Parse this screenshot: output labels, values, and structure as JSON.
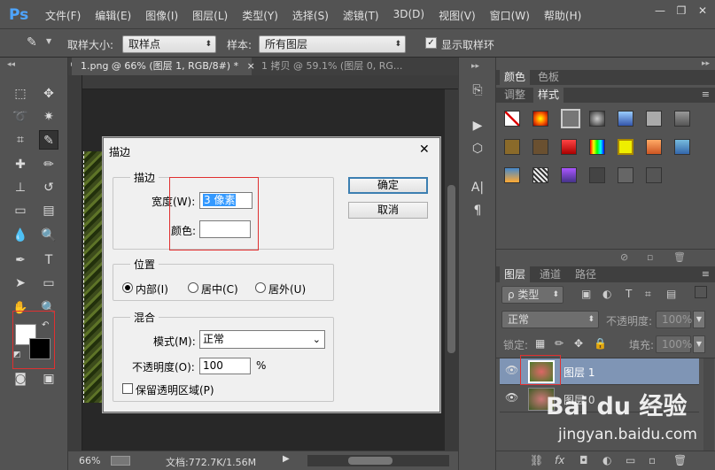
{
  "app": {
    "logo": "Ps"
  },
  "menu": [
    "文件(F)",
    "编辑(E)",
    "图像(I)",
    "图层(L)",
    "类型(Y)",
    "选择(S)",
    "滤镜(T)",
    "3D(D)",
    "视图(V)",
    "窗口(W)",
    "帮助(H)"
  ],
  "window_controls": {
    "minimize": "—",
    "restore": "❐",
    "close": "✕"
  },
  "options": {
    "sample_size_label": "取样大小:",
    "sample_size_value": "取样点",
    "sample_label": "样本:",
    "sample_value": "所有图层",
    "show_ring_label": "显示取样环",
    "show_ring_checked": true
  },
  "tabs": [
    {
      "label": "1.png @ 66% (图层 1, RGB/8#) *",
      "close": "×",
      "active": true
    },
    {
      "label": "1 拷贝 @ 59.1% (图层 0, RG...",
      "active": false
    }
  ],
  "status": {
    "zoom": "66%",
    "doc": "文档:772.7K/1.56M"
  },
  "color_panel": {
    "tabs": [
      "颜色",
      "色板"
    ],
    "tabs2": [
      "调整",
      "样式"
    ]
  },
  "layers_panel": {
    "tabs": [
      "图层",
      "通道",
      "路径"
    ],
    "filter_label": "ρ 类型",
    "blend_mode": "正常",
    "opacity_label": "不透明度:",
    "opacity_value": "100%",
    "lock_label": "锁定:",
    "fill_label": "填充:",
    "fill_value": "100%",
    "layers": [
      {
        "name": "图层 1",
        "selected": true
      },
      {
        "name": "图层 0",
        "selected": false
      }
    ]
  },
  "dialog": {
    "title": "描边",
    "close": "✕",
    "stroke_group": "描边",
    "width_label": "宽度(W):",
    "width_value": "3 像素",
    "color_label": "颜色:",
    "position_group": "位置",
    "pos_inside": "内部(I)",
    "pos_center": "居中(C)",
    "pos_outside": "居外(U)",
    "pos_selected": "inside",
    "blend_group": "混合",
    "mode_label": "模式(M):",
    "mode_value": "正常",
    "opacity_label": "不透明度(O):",
    "opacity_value": "100",
    "opacity_unit": "%",
    "preserve_label": "保留透明区域(P)",
    "ok": "确定",
    "cancel": "取消"
  },
  "watermark": {
    "logo": "Bai du 经验",
    "url": "jingyan.baidu.com"
  }
}
